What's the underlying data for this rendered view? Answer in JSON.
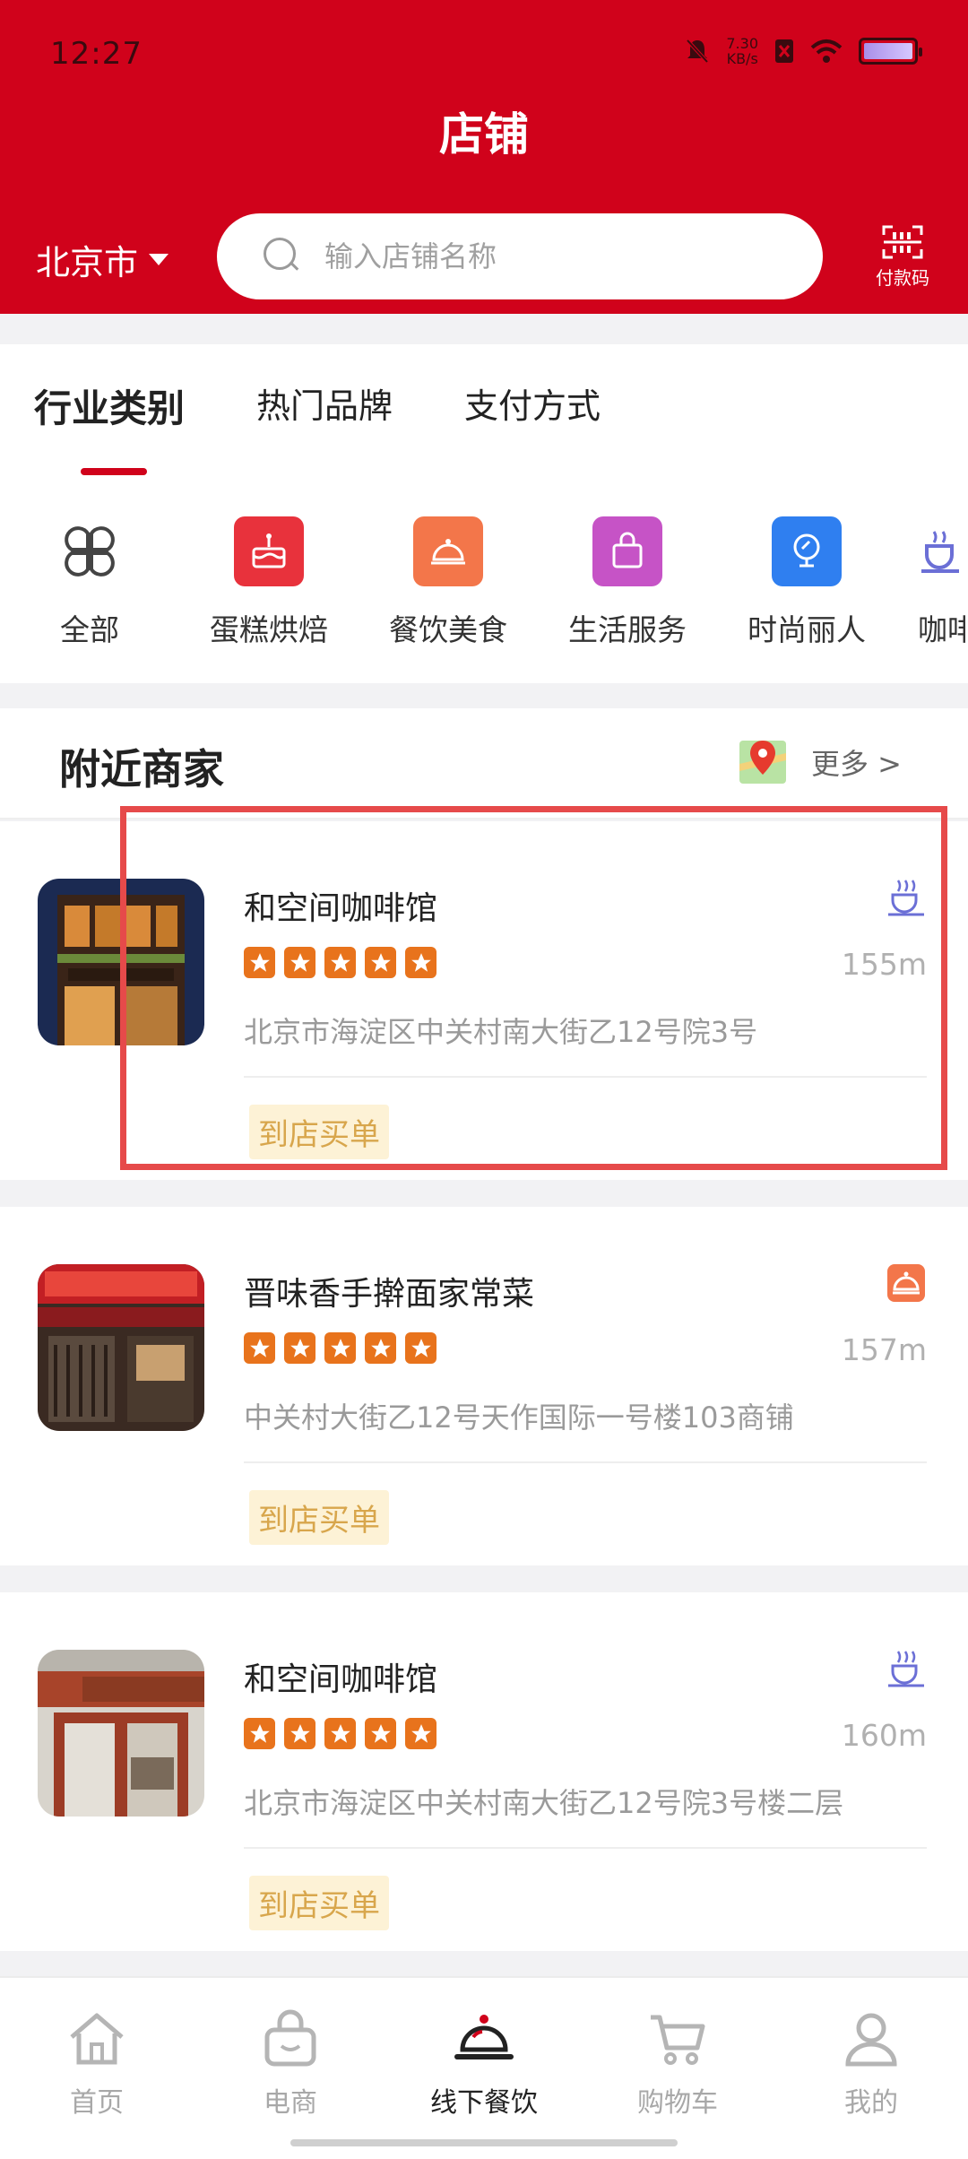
{
  "status_bar": {
    "time": "12:27",
    "net_speed_value": "7.30",
    "net_speed_unit": "KB/s"
  },
  "header": {
    "title": "店铺",
    "city": "北京市",
    "search_placeholder": "输入店铺名称",
    "paycode_label": "付款码",
    "accent": "#d0021b"
  },
  "category": {
    "tabs": [
      "行业类别",
      "热门品牌",
      "支付方式"
    ],
    "items": [
      {
        "label": "全部",
        "icon": "grid-icon"
      },
      {
        "label": "蛋糕烘焙",
        "icon": "cake-icon",
        "color": "#e8323c"
      },
      {
        "label": "餐饮美食",
        "icon": "dish-icon",
        "color": "#f3764a"
      },
      {
        "label": "生活服务",
        "icon": "bag-icon",
        "color": "#c653c6"
      },
      {
        "label": "时尚丽人",
        "icon": "mirror-icon",
        "color": "#2f7ff0"
      },
      {
        "label": "咖啡",
        "icon": "coffee-icon",
        "color": "#6b6fd6"
      }
    ]
  },
  "nearby": {
    "title": "附近商家",
    "more": "更多 >",
    "shops": [
      {
        "name": "和空间咖啡馆",
        "rating": 5,
        "distance": "155m",
        "address": "北京市海淀区中关村南大街乙12号院3号",
        "action": "到店买单",
        "category_icon": "coffee-icon"
      },
      {
        "name": "晋味香手擀面家常菜",
        "rating": 5,
        "distance": "157m",
        "address": "中关村大街乙12号天作国际一号楼103商铺",
        "action": "到店买单",
        "category_icon": "dish-icon"
      },
      {
        "name": "和空间咖啡馆",
        "rating": 5,
        "distance": "160m",
        "address": "北京市海淀区中关村南大街乙12号院3号楼二层",
        "action": "到店买单",
        "category_icon": "coffee-icon"
      }
    ]
  },
  "bottom_nav": {
    "items": [
      {
        "label": "首页",
        "icon": "home-icon"
      },
      {
        "label": "电商",
        "icon": "shopping-bag-icon"
      },
      {
        "label": "线下餐饮",
        "icon": "service-bell-icon",
        "active": true
      },
      {
        "label": "购物车",
        "icon": "cart-icon"
      },
      {
        "label": "我的",
        "icon": "user-icon"
      }
    ]
  }
}
